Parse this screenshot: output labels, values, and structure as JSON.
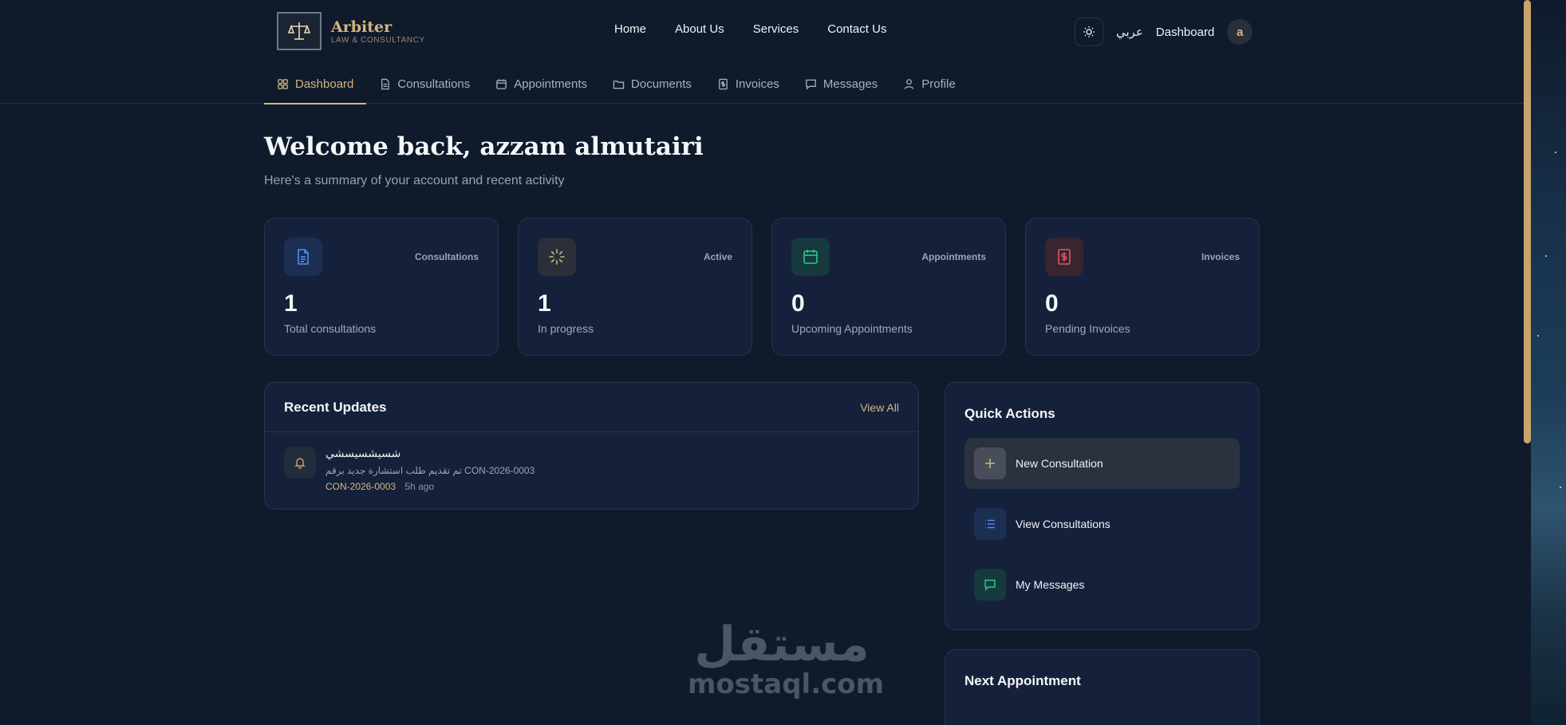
{
  "brand": {
    "name": "Arbiter",
    "tagline": "LAW & CONSULTANCY"
  },
  "main_nav": [
    "Home",
    "About Us",
    "Services",
    "Contact Us"
  ],
  "header": {
    "language": "عربي",
    "dashboard_link": "Dashboard",
    "avatar_initial": "a"
  },
  "tabs": [
    {
      "label": "Dashboard",
      "icon": "grid-icon",
      "active": true
    },
    {
      "label": "Consultations",
      "icon": "file-icon",
      "active": false
    },
    {
      "label": "Appointments",
      "icon": "calendar-icon",
      "active": false
    },
    {
      "label": "Documents",
      "icon": "folder-icon",
      "active": false
    },
    {
      "label": "Invoices",
      "icon": "receipt-icon",
      "active": false
    },
    {
      "label": "Messages",
      "icon": "message-icon",
      "active": false
    },
    {
      "label": "Profile",
      "icon": "user-icon",
      "active": false
    }
  ],
  "welcome": {
    "title": "Welcome back, azzam almutairi",
    "subtitle": "Here's a summary of your account and recent activity"
  },
  "stats": [
    {
      "tag": "Consultations",
      "value": "1",
      "label": "Total consultations",
      "icon": "document-icon",
      "color": "#4f8ef7"
    },
    {
      "tag": "Active",
      "value": "1",
      "label": "In progress",
      "icon": "loader-icon",
      "color": "#d5b57f"
    },
    {
      "tag": "Appointments",
      "value": "0",
      "label": "Upcoming Appointments",
      "icon": "calendar-icon",
      "color": "#2ec98a"
    },
    {
      "tag": "Invoices",
      "value": "0",
      "label": "Pending Invoices",
      "icon": "invoice-icon",
      "color": "#e0565b"
    }
  ],
  "recent_updates": {
    "title": "Recent Updates",
    "view_all": "View All",
    "items": [
      {
        "title": "شسيشسيسشي",
        "description": "تم تقديم طلب استشارة جديد برقم CON-2026-0003",
        "reference": "CON-2026-0003",
        "time": "5h ago"
      }
    ]
  },
  "quick_actions": {
    "title": "Quick Actions",
    "items": [
      {
        "label": "New Consultation",
        "icon": "plus-icon"
      },
      {
        "label": "View Consultations",
        "icon": "list-icon"
      },
      {
        "label": "My Messages",
        "icon": "message-icon"
      }
    ]
  },
  "next_appointment": {
    "title": "Next Appointment"
  },
  "watermark": {
    "arabic": "مستقل",
    "latin": "mostaql.com"
  },
  "colors": {
    "accent": "#d5b57f",
    "background": "#0f1a2b",
    "card": "#15213a"
  }
}
